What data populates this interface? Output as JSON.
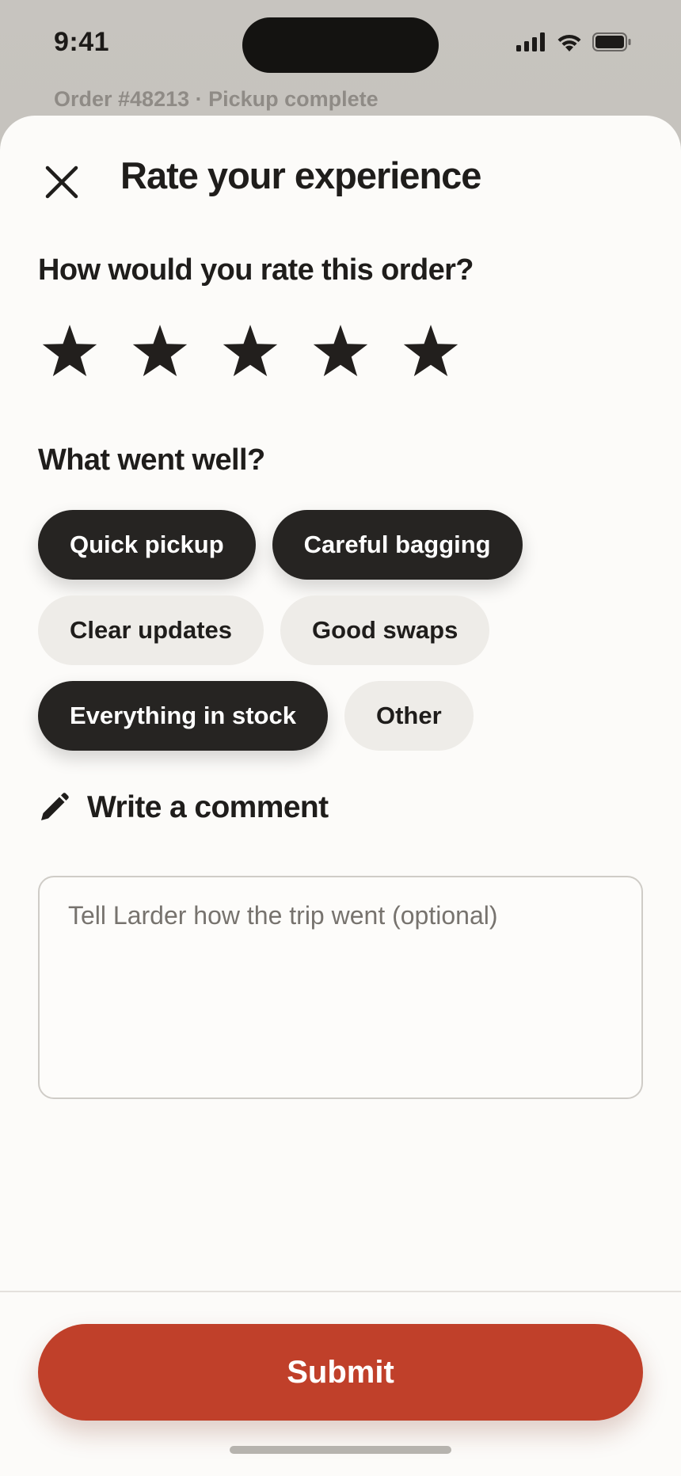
{
  "status_bar": {
    "time": "9:41"
  },
  "background": {
    "order_summary": "Order #48213 · Pickup complete"
  },
  "sheet": {
    "title": "Rate your experience",
    "rating": {
      "question": "How would you rate this order?",
      "value": 5,
      "max": 5
    },
    "went_well": {
      "heading": "What went well?",
      "chips": [
        {
          "label": "Quick pickup",
          "selected": true
        },
        {
          "label": "Careful bagging",
          "selected": true
        },
        {
          "label": "Clear updates",
          "selected": false
        },
        {
          "label": "Good swaps",
          "selected": false
        },
        {
          "label": "Everything in stock",
          "selected": true
        },
        {
          "label": "Other",
          "selected": false
        }
      ]
    },
    "comment": {
      "label": "Write a comment",
      "placeholder": "Tell Larder how the trip went (optional)",
      "value": ""
    },
    "submit_label": "Submit"
  },
  "colors": {
    "accent": "#c0402a",
    "chip_selected": "#262422",
    "chip_unselected": "#eeece8",
    "sheet_bg": "#fcfbf9"
  }
}
